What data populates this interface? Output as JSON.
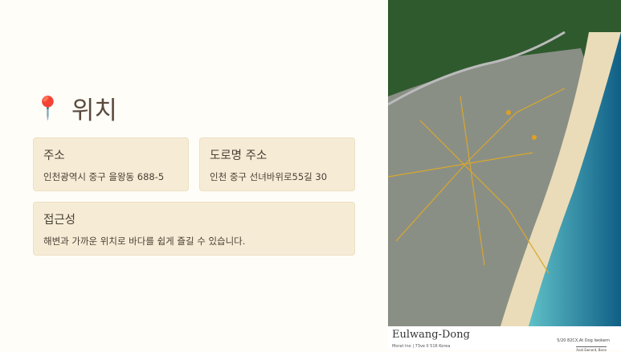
{
  "title": {
    "icon": "round-pushpin-icon",
    "text": "위치"
  },
  "cards": [
    {
      "label": "주소",
      "value": "인천광역시 중구 을왕동 688-5"
    },
    {
      "label": "도로명 주소",
      "value": "인천 중구 선녀바위로55길 30"
    },
    {
      "label": "접근성",
      "value": "해변과 가까운 위치로 바다를 쉽게 즐길 수 있습니다."
    }
  ],
  "map": {
    "caption": "Eulwang-Dong",
    "subcaption": "Morat Ino | 73ve II 516 Korea",
    "right_top": "5/20 82CX,At Dog Iwokern",
    "right_bottom": "Asat Ewnord, Bone",
    "colors": {
      "forest": "#2f5a2e",
      "sea": "#1f7fa3",
      "sand": "#eadcb8",
      "city": "#8a8f86"
    }
  }
}
